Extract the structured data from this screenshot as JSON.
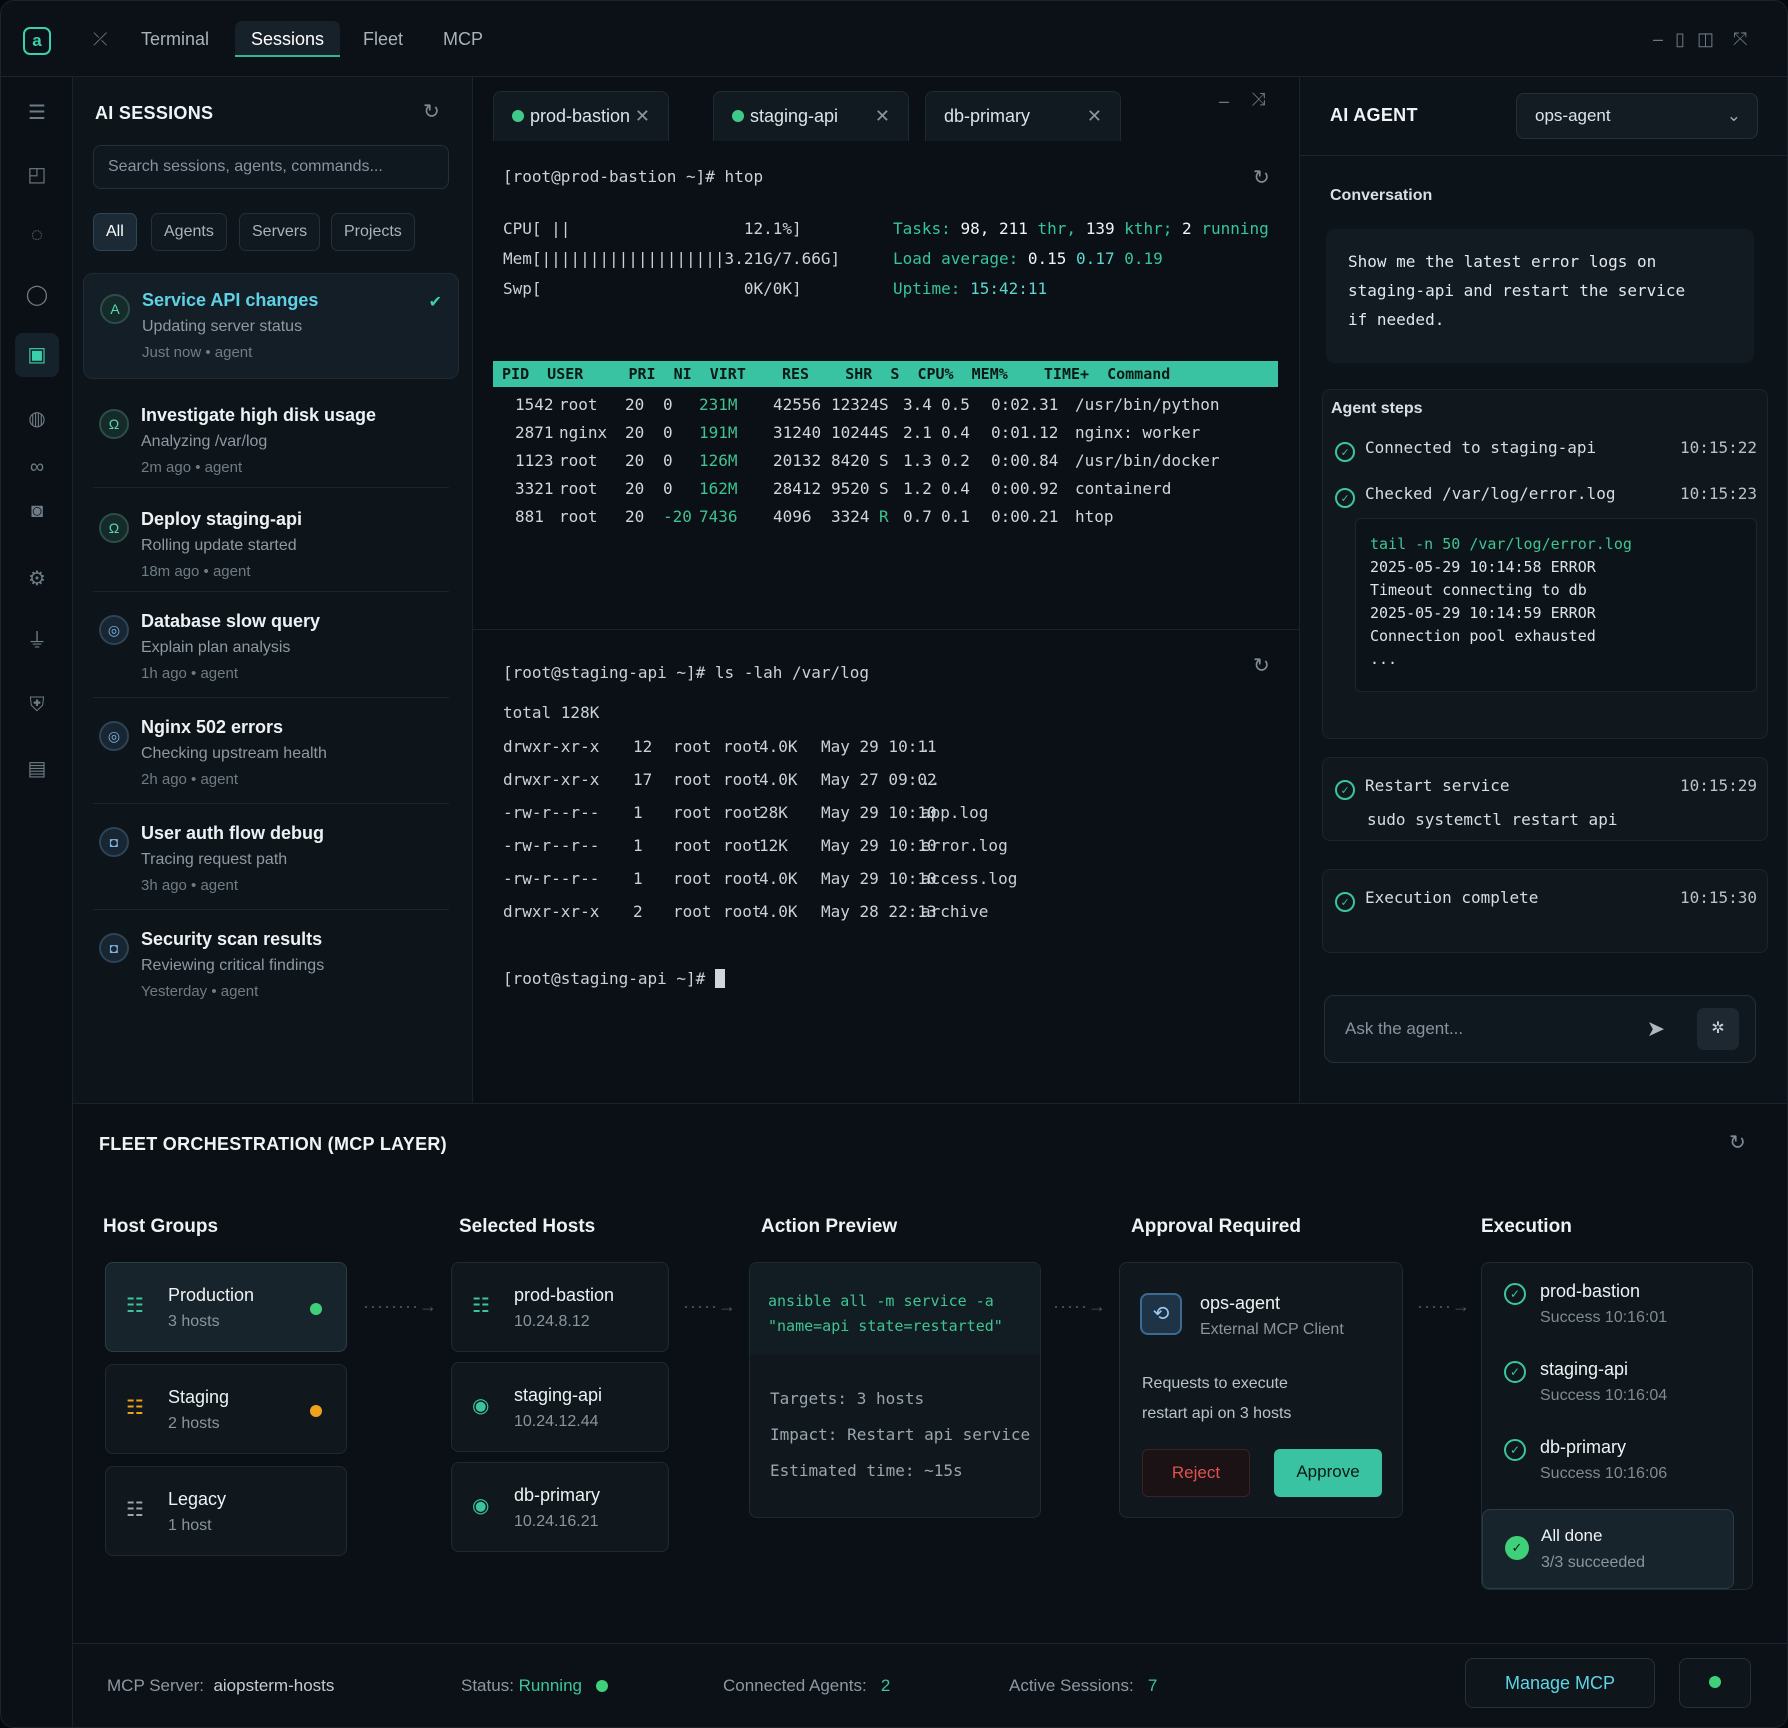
{
  "topbar": {
    "tabs": [
      "Terminal",
      "Sessions",
      "Fleet",
      "MCP"
    ],
    "active_tab": "Sessions"
  },
  "sessions": {
    "title": "AI SESSIONS",
    "search_placeholder": "Search sessions, agents, commands...",
    "filters": [
      "All",
      "Agents",
      "Servers",
      "Projects"
    ],
    "items": [
      {
        "title": "Service API changes",
        "subtitle": "Updating server status",
        "time": "Just now • agent"
      },
      {
        "title": "Investigate high disk usage",
        "subtitle": "Analyzing /var/log",
        "time": "2m ago • agent"
      },
      {
        "title": "Deploy staging-api",
        "subtitle": "Rolling update started",
        "time": "18m ago • agent"
      },
      {
        "title": "Database slow query",
        "subtitle": "Explain plan analysis",
        "time": "1h ago • agent"
      },
      {
        "title": "Nginx 502 errors",
        "subtitle": "Checking upstream health",
        "time": "2h ago • agent"
      },
      {
        "title": "User auth flow debug",
        "subtitle": "Tracing request path",
        "time": "3h ago • agent"
      },
      {
        "title": "Security scan results",
        "subtitle": "Reviewing critical findings",
        "time": "Yesterday • agent"
      }
    ]
  },
  "terminal": {
    "tabs": [
      "prod-bastion",
      "staging-api",
      "db-primary"
    ],
    "pane1": {
      "prompt": "[root@prod-bastion ~]# htop",
      "cpu": "CPU[ ||                  12.1%]",
      "mem": "Mem[|||||||||||||||||||3.21G/7.66G]",
      "swp": "Swp[                     0K/0K]",
      "tasks_label": "Tasks:",
      "tasks_val": "98, 211",
      "tasks_thr": "thr,",
      "tasks_k": "139",
      "tasks_kthr": "kthr;",
      "tasks_run": "2",
      "tasks_running": "running",
      "load_label": "Load average:",
      "load1": "0.15",
      "load5": "0.17",
      "load15": "0.19",
      "uptime_label": "Uptime:",
      "uptime": "15:42:11",
      "header": " PID  USER     PRI  NI  VIRT    RES    SHR  S  CPU%  MEM%    TIME+  Command",
      "procs": [
        [
          "1542",
          "root",
          "20",
          "0",
          "231M",
          "42556",
          "12324",
          "S",
          "3.4",
          "0.5",
          "0:02.31",
          "/usr/bin/python"
        ],
        [
          "2871",
          "nginx",
          "20",
          "0",
          "191M",
          "31240",
          "10244",
          "S",
          "2.1",
          "0.4",
          "0:01.12",
          "nginx: worker"
        ],
        [
          "1123",
          "root",
          "20",
          "0",
          "126M",
          "20132",
          "8420",
          "S",
          "1.3",
          "0.2",
          "0:00.84",
          "/usr/bin/docker"
        ],
        [
          "3321",
          "root",
          "20",
          "0",
          "162M",
          "28412",
          "9520",
          "S",
          "1.2",
          "0.4",
          "0:00.92",
          "containerd"
        ],
        [
          "881",
          "root",
          "20",
          "-20",
          "7436",
          "4096",
          "3324",
          "R",
          "0.7",
          "0.1",
          "0:00.21",
          "htop"
        ]
      ]
    },
    "pane2": {
      "prompt": "[root@staging-api ~]# ls -lah /var/log",
      "total": "total 128K",
      "rows": [
        [
          "drwxr-xr-x",
          "12",
          "root",
          "root",
          "4.0K",
          "May 29 10:11",
          "."
        ],
        [
          "drwxr-xr-x",
          "17",
          "root",
          "root",
          "4.0K",
          "May 27 09:02",
          ".."
        ],
        [
          "-rw-r--r--",
          "1",
          "root",
          "root",
          "28K",
          "May 29 10:10",
          "app.log"
        ],
        [
          "-rw-r--r--",
          "1",
          "root",
          "root",
          "12K",
          "May 29 10:10",
          "error.log"
        ],
        [
          "-rw-r--r--",
          "1",
          "root",
          "root",
          "4.0K",
          "May 29 10:10",
          "access.log"
        ],
        [
          "drwxr-xr-x",
          "2",
          "root",
          "root",
          "4.0K",
          "May 28 22:13",
          "archive"
        ]
      ],
      "prompt2": "[root@staging-api ~]#"
    }
  },
  "agent": {
    "title": "AI AGENT",
    "selected_agent": "ops-agent",
    "conversation_label": "Conversation",
    "message_l1": "Show me the latest error logs on",
    "message_l2": "staging-api and restart the service",
    "message_l3": "if needed.",
    "steps_label": "Agent steps",
    "steps": [
      {
        "label": "Connected to staging-api",
        "time": "10:15:22"
      },
      {
        "label": "Checked /var/log/error.log",
        "time": "10:15:23"
      }
    ],
    "code_cmd": "tail -n 50 /var/log/error.log",
    "code_l1": "2025-05-29 10:14:58 ERROR",
    "code_l2": "Timeout connecting to db",
    "code_l3": "2025-05-29 10:14:59 ERROR",
    "code_l4": "Connection pool exhausted",
    "code_l5": "...",
    "restart_label": "Restart service",
    "restart_time": "10:15:29",
    "restart_cmd": "sudo systemctl restart api",
    "complete_label": "Execution complete",
    "complete_time": "10:15:30",
    "ask_placeholder": "Ask the agent..."
  },
  "fleet": {
    "title": "FLEET ORCHESTRATION (MCP LAYER)",
    "columns": [
      "Host Groups",
      "Selected Hosts",
      "Action Preview",
      "Approval Required",
      "Execution"
    ],
    "groups": [
      {
        "name": "Production",
        "count": "3 hosts",
        "color": "#3fd07a"
      },
      {
        "name": "Staging",
        "count": "2 hosts",
        "color": "#f0a21a"
      },
      {
        "name": "Legacy",
        "count": "1 host"
      }
    ],
    "hosts": [
      {
        "name": "prod-bastion",
        "ip": "10.24.8.12"
      },
      {
        "name": "staging-api",
        "ip": "10.24.12.44"
      },
      {
        "name": "db-primary",
        "ip": "10.24.16.21"
      }
    ],
    "preview": {
      "cmd_l1": "ansible all -m service -a",
      "cmd_l2": "\"name=api state=restarted\"",
      "targets": "Targets:  3 hosts",
      "impact": "Impact:  Restart api service",
      "eta": "Estimated time:  ~15s"
    },
    "approval": {
      "agent": "ops-agent",
      "client": "External MCP Client",
      "req_l1": "Requests to execute",
      "req_l2": "restart api on 3 hosts",
      "reject": "Reject",
      "approve": "Approve"
    },
    "execution": [
      {
        "name": "prod-bastion",
        "status": "Success 10:16:01"
      },
      {
        "name": "staging-api",
        "status": "Success 10:16:04"
      },
      {
        "name": "db-primary",
        "status": "Success 10:16:06"
      }
    ],
    "done_title": "All done",
    "done_sub": "3/3 succeeded"
  },
  "status": {
    "server_label": "MCP Server:",
    "server": "aiopsterm-hosts",
    "status_label": "Status:",
    "status": "Running",
    "agents_label": "Connected Agents:",
    "agents": "2",
    "sessions_label": "Active Sessions:",
    "sessions": "7",
    "manage": "Manage MCP"
  },
  "colors": {
    "accent": "#3ac3a2",
    "success": "#3fd07a",
    "warning": "#f0a21a",
    "danger": "#e0524f"
  }
}
